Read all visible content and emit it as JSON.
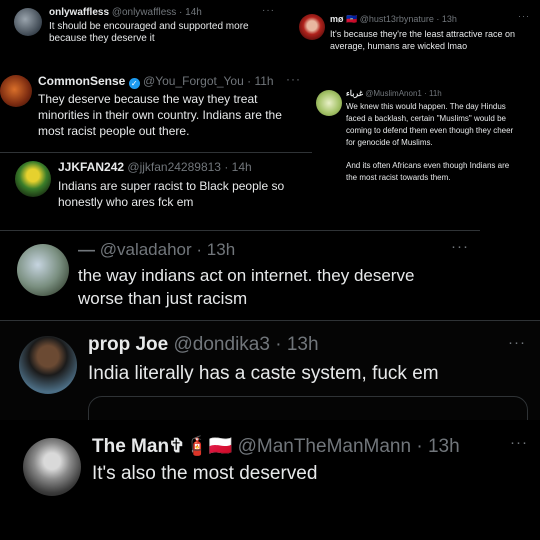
{
  "tweets": [
    {
      "name": "onlywaffless",
      "handle": "@onlywaffless",
      "time": "14h",
      "more": "···",
      "lines": [
        "It should be encouraged and supported more",
        "because they deserve it"
      ]
    },
    {
      "name": "mø 🇭🇹",
      "handle": "@hust13rbynature",
      "time": "13h",
      "more": "···",
      "lines": [
        "It's because they're the least attractive race on",
        "average, humans are wicked lmao"
      ]
    },
    {
      "name": "CommonSense",
      "handle": "@You_Forgot_You",
      "time": "11h",
      "more": "···",
      "lines": [
        "They deserve because the way they treat",
        "minorities in their own country. Indians are the",
        "most racist people out there."
      ]
    },
    {
      "name": "غرباء",
      "handle": "@MuslimAnon1",
      "time": "11h",
      "lines": [
        "We knew this would happen. The day Hindus",
        "faced a backlash, certain \"Muslims\" would be",
        "coming to defend them even though they cheer",
        "for genocide of Muslims.",
        "",
        "And its often Africans even though Indians are",
        "the most racist towards them."
      ]
    },
    {
      "name": "JJKFAN242",
      "handle": "@jjkfan24289813",
      "time": "14h",
      "lines": [
        "Indians are super racist to Black people so",
        "honestly who ares fck em"
      ]
    },
    {
      "name": "—",
      "handle": "@valadahor",
      "time": "13h",
      "more": "···",
      "lines": [
        "the way indians act on internet. they deserve",
        "worse than just racism"
      ]
    },
    {
      "name": "prop Joe",
      "handle": "@dondika3",
      "time": "13h",
      "more": "···",
      "lines": [
        "India literally has a caste system, fuck em"
      ]
    },
    {
      "name": "The Man✞🧯🇵🇱",
      "handle": "@ManTheManMann",
      "time": "13h",
      "more": "···",
      "lines": [
        "It's also the most deserved"
      ]
    }
  ]
}
